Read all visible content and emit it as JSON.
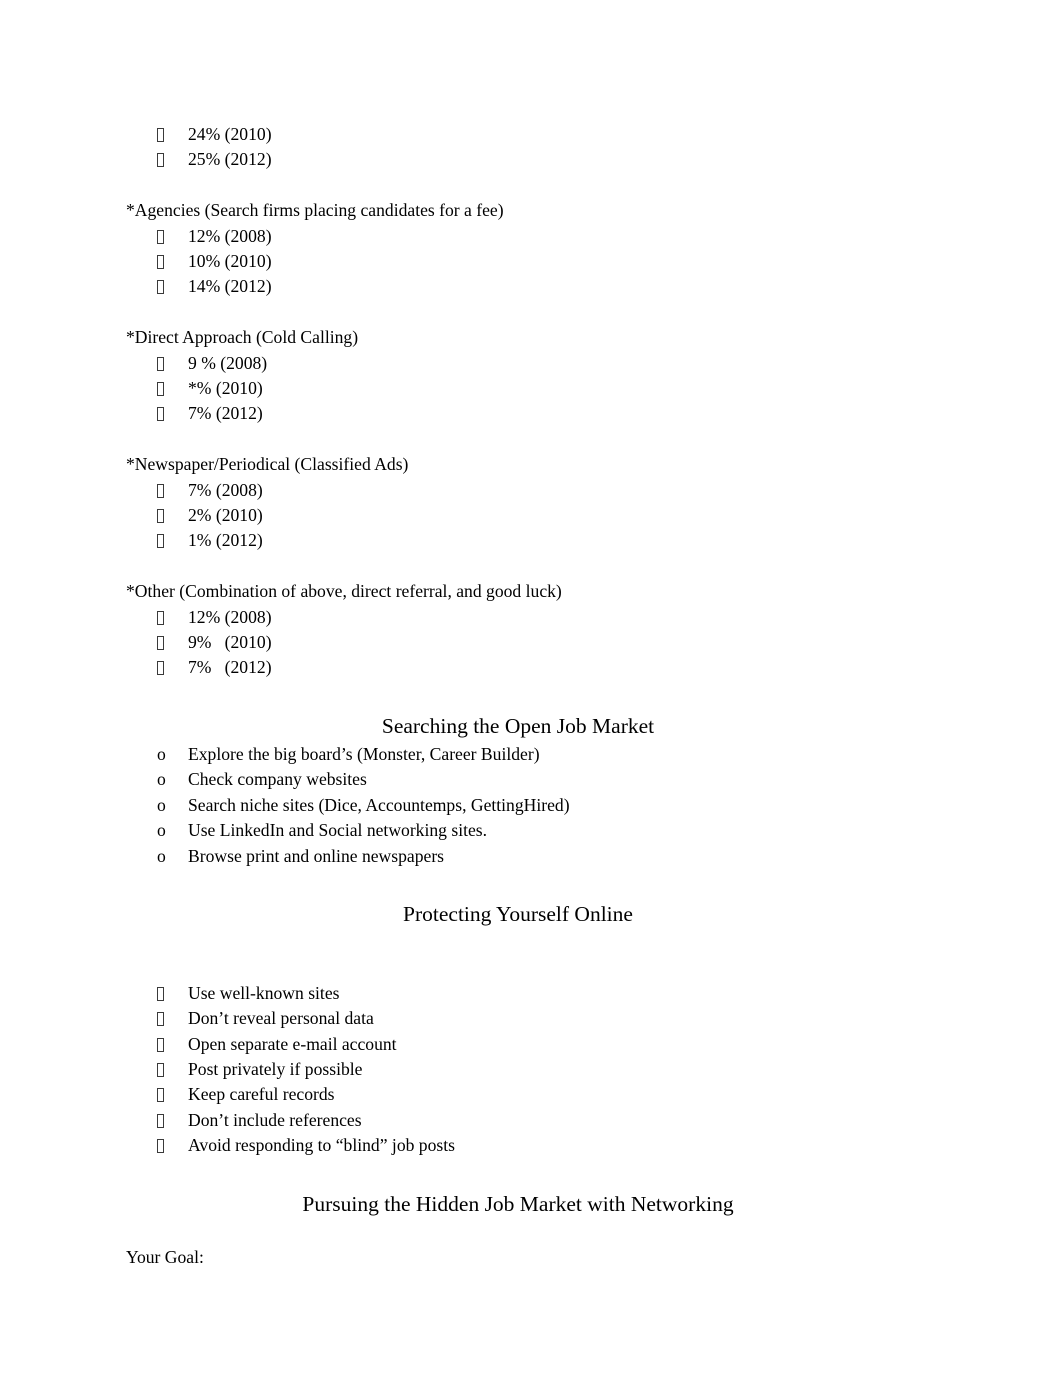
{
  "document": {
    "page_background": "#ffffff",
    "text_color": "#000000",
    "bullet_glyph_tofu": "missing-glyph-box",
    "bullet_glyph_o": "o"
  },
  "sections": [
    {
      "id": "continued-stats",
      "heading": null,
      "items": [
        {
          "marker": "tofu",
          "text": "24% (2010)"
        },
        {
          "marker": "tofu",
          "text": "25% (2012)"
        }
      ]
    },
    {
      "id": "agencies",
      "lead": "*Agencies (Search firms placing candidates for a fee)",
      "items": [
        {
          "marker": "tofu",
          "text": "12% (2008)"
        },
        {
          "marker": "tofu",
          "text": "10% (2010)"
        },
        {
          "marker": "tofu",
          "text": "14% (2012)"
        }
      ]
    },
    {
      "id": "direct-approach",
      "lead": "*Direct Approach (Cold Calling)",
      "items": [
        {
          "marker": "tofu",
          "text": "9 % (2008)"
        },
        {
          "marker": "tofu",
          "text": "*% (2010)"
        },
        {
          "marker": "tofu",
          "text": "7% (2012)"
        }
      ]
    },
    {
      "id": "newspaper-periodical",
      "lead": "*Newspaper/Periodical (Classified Ads)",
      "items": [
        {
          "marker": "tofu",
          "text": "7% (2008)"
        },
        {
          "marker": "tofu",
          "text": "2% (2010)"
        },
        {
          "marker": "tofu",
          "text": "1% (2012)"
        }
      ]
    },
    {
      "id": "other",
      "lead": "*Other (Combination of above, direct referral, and good luck)",
      "items": [
        {
          "marker": "tofu",
          "text": "12% (2008)"
        },
        {
          "marker": "tofu",
          "text": "9%   (2010)"
        },
        {
          "marker": "tofu",
          "text": "7%   (2012)"
        }
      ]
    },
    {
      "id": "searching-open-job-market",
      "heading": "Searching the Open Job Market",
      "items": [
        {
          "marker": "o",
          "text": "Explore the big board’s (Monster, Career Builder)"
        },
        {
          "marker": "o",
          "text": "Check company websites"
        },
        {
          "marker": "o",
          "text": "Search niche sites (Dice, Accountemps, GettingHired)"
        },
        {
          "marker": "o",
          "text": "Use LinkedIn and Social networking sites."
        },
        {
          "marker": "o",
          "text": "Browse print and online newspapers"
        }
      ]
    },
    {
      "id": "protecting-yourself-online",
      "heading": "Protecting Yourself Online",
      "items": [
        {
          "marker": "tofu",
          "text": "Use well-known sites"
        },
        {
          "marker": "tofu",
          "text": "Don’t reveal personal data"
        },
        {
          "marker": "tofu",
          "text": "Open separate e-mail account"
        },
        {
          "marker": "tofu",
          "text": "Post privately if possible"
        },
        {
          "marker": "tofu",
          "text": "Keep careful records"
        },
        {
          "marker": "tofu",
          "text": "Don’t include references"
        },
        {
          "marker": "tofu",
          "text": "Avoid responding to “blind” job posts"
        }
      ]
    },
    {
      "id": "pursuing-hidden-job-market",
      "heading": "Pursuing the Hidden Job Market with Networking",
      "items": [],
      "footer_text": "Your Goal:"
    }
  ]
}
